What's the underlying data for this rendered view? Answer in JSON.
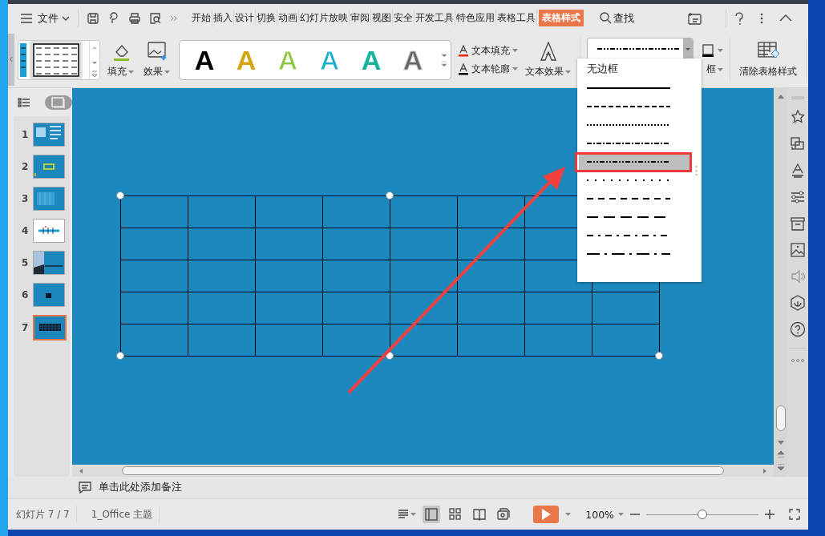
{
  "menu_bar": {
    "file_menu": "文件",
    "tabs": [
      {
        "label": "开始",
        "selected": false
      },
      {
        "label": "插入",
        "selected": false
      },
      {
        "label": "设计",
        "selected": false
      },
      {
        "label": "切换",
        "selected": false
      },
      {
        "label": "动画",
        "selected": false
      },
      {
        "label": "幻灯片放映",
        "selected": false
      },
      {
        "label": "审阅",
        "selected": false
      },
      {
        "label": "视图",
        "selected": false
      },
      {
        "label": "安全",
        "selected": false
      },
      {
        "label": "开发工具",
        "selected": false
      },
      {
        "label": "特色应用",
        "selected": false
      },
      {
        "label": "表格工具",
        "selected": false
      },
      {
        "label": "表格样式",
        "selected": true
      }
    ],
    "search": "查找"
  },
  "ribbon": {
    "fill": "填充",
    "effects": "效果",
    "wordart_styles": [
      {
        "letter": "A",
        "kind": "solid",
        "color": "#000000"
      },
      {
        "letter": "A",
        "kind": "solid",
        "color": "#d4a514"
      },
      {
        "letter": "A",
        "kind": "outline",
        "color": "#8cc63f"
      },
      {
        "letter": "A",
        "kind": "outline",
        "color": "#1aaed0"
      },
      {
        "letter": "A",
        "kind": "solid",
        "color": "#14b39a"
      },
      {
        "letter": "A",
        "kind": "gradient",
        "color": "#666666"
      }
    ],
    "text_fill": "文本填充",
    "text_outline": "文本轮廓",
    "text_effects": "文本效果",
    "border": "框",
    "clear_table_style": "清除表格样式"
  },
  "border_style_menu": {
    "no_border": "无边框",
    "styles": [
      {
        "kind": "solid",
        "selected": false
      },
      {
        "kind": "dash",
        "selected": false
      },
      {
        "kind": "dot",
        "selected": false
      },
      {
        "kind": "dash-dot",
        "selected": false
      },
      {
        "kind": "dash-dot-dot",
        "selected": true
      },
      {
        "kind": "sparse-dot",
        "selected": false
      },
      {
        "kind": "spaced-dash",
        "selected": false
      },
      {
        "kind": "long-dash",
        "selected": false
      },
      {
        "kind": "dash-dot-spaced",
        "selected": false
      },
      {
        "kind": "long-dash-dot",
        "selected": false
      }
    ]
  },
  "slide_view_toggle": {
    "on": true
  },
  "slides": [
    {
      "number": "1",
      "selected": false
    },
    {
      "number": "2",
      "selected": false
    },
    {
      "number": "3",
      "selected": false
    },
    {
      "number": "4",
      "selected": false
    },
    {
      "number": "5",
      "selected": false
    },
    {
      "number": "6",
      "selected": false
    },
    {
      "number": "7",
      "selected": true
    }
  ],
  "slide": {
    "table": {
      "selected": true,
      "rows": [
        [
          {},
          {},
          {},
          {},
          {},
          {},
          {},
          {}
        ],
        [
          {},
          {},
          {},
          {},
          {},
          {},
          {},
          {}
        ],
        [
          {},
          {},
          {},
          {},
          {},
          {},
          {},
          {}
        ],
        [
          {},
          {},
          {},
          {},
          {},
          {},
          {},
          {}
        ],
        [
          {},
          {},
          {},
          {},
          {},
          {},
          {},
          {}
        ]
      ]
    }
  },
  "notes": {
    "placeholder": "单击此处添加备注"
  },
  "status_bar": {
    "slide_counter": "幻灯片 7 / 7",
    "theme": "1_Office 主题",
    "views": [
      {
        "kind": "normal",
        "selected": true
      },
      {
        "kind": "sorter",
        "selected": false
      },
      {
        "kind": "reading",
        "selected": false
      },
      {
        "kind": "presenter",
        "selected": false
      }
    ],
    "zoom": "100%",
    "zoom_slider": {
      "level": 0.5
    }
  }
}
